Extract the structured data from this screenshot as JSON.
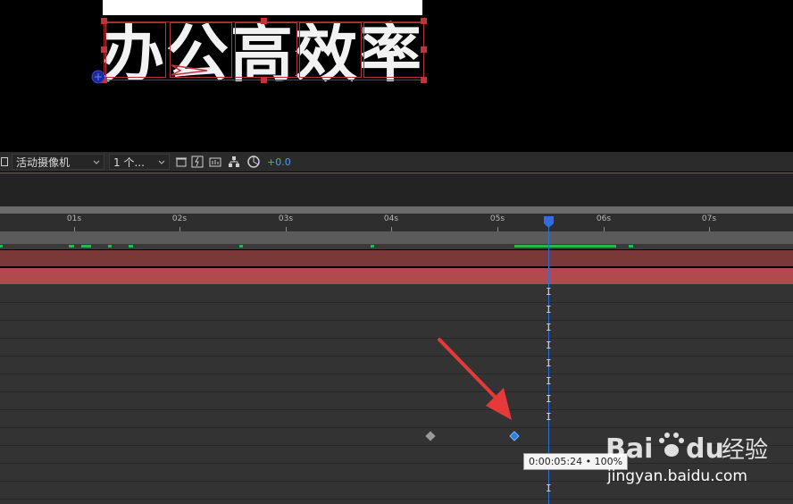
{
  "viewer": {
    "title_text": "办公高效率"
  },
  "toolbar": {
    "camera_dropdown": "活动摄像机",
    "views_dropdown": "1 个...",
    "exposure_value": "+0.0"
  },
  "ruler": {
    "labels": [
      "01s",
      "02s",
      "03s",
      "04s",
      "05s",
      "06s",
      "07s"
    ]
  },
  "tooltip": {
    "text": "0:00:05:24 • 100%"
  },
  "watermark": {
    "brand": "Baidu经验",
    "url": "jingyan.baidu.com"
  },
  "colors": {
    "accent": "#2d6fe0",
    "layer_bar": "#b04a4f",
    "cache": "#2bb54a",
    "annotation": "#e63a3a"
  }
}
